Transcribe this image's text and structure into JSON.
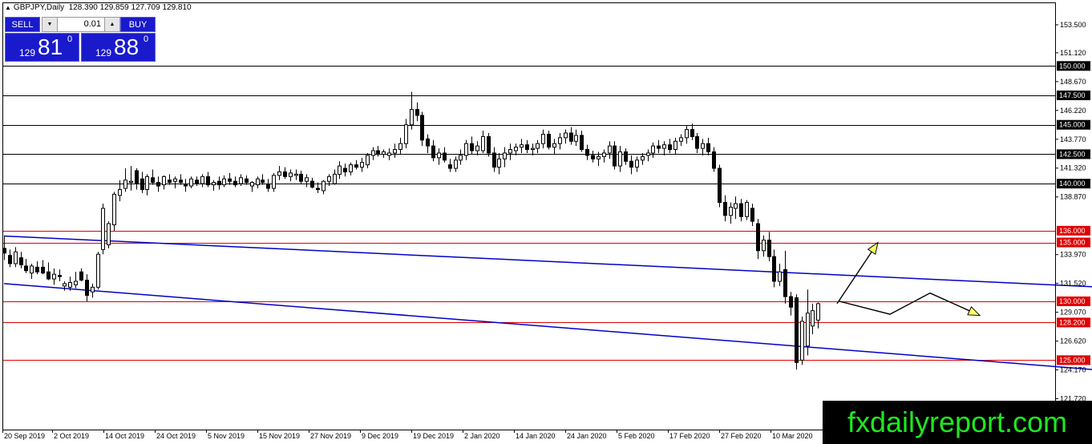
{
  "header": {
    "symbol": "GBPJPY,Daily",
    "ohlc": "128.390 129.859 127.709 129.810"
  },
  "trade_panel": {
    "sell_label": "SELL",
    "buy_label": "BUY",
    "lot": "0.01",
    "sell_prefix": "129",
    "sell_big": "81",
    "sell_sup": "0",
    "buy_prefix": "129",
    "buy_big": "88",
    "buy_sup": "0"
  },
  "watermark": "fxdailyreport.com",
  "colors": {
    "background": "#ffffff",
    "bull_candle": "#ffffff",
    "bear_candle": "#000000",
    "black_level": "#000000",
    "red_level": "#e00000",
    "trendline": "#0000c8",
    "arrow_fill": "#ffff66",
    "panel_blue": "#1a1acd",
    "watermark_text": "#1ee81e"
  },
  "chart_data": {
    "type": "candlestick",
    "title": "GBPJPY,Daily",
    "xlabel": "",
    "ylabel": "",
    "ylim": [
      119.1,
      155.4
    ],
    "y_ticks": [
      "153.500",
      "151.120",
      "148.670",
      "146.220",
      "143.770",
      "141.320",
      "138.870",
      "133.970",
      "131.520",
      "129.070",
      "126.620",
      "124.170",
      "121.720"
    ],
    "x_ticks": [
      "20 Sep 2019",
      "2 Oct 2019",
      "14 Oct 2019",
      "24 Oct 2019",
      "5 Nov 2019",
      "15 Nov 2019",
      "27 Nov 2019",
      "9 Dec 2019",
      "19 Dec 2019",
      "2 Jan 2020",
      "14 Jan 2020",
      "24 Jan 2020",
      "5 Feb 2020",
      "17 Feb 2020",
      "27 Feb 2020",
      "10 Mar 2020"
    ],
    "levels": [
      {
        "price": 150.0,
        "label": "150.000",
        "style": "black"
      },
      {
        "price": 147.5,
        "label": "147.500",
        "style": "black"
      },
      {
        "price": 145.0,
        "label": "145.000",
        "style": "black"
      },
      {
        "price": 142.5,
        "label": "142.500",
        "style": "black"
      },
      {
        "price": 140.0,
        "label": "140.000",
        "style": "black"
      },
      {
        "price": 136.0,
        "label": "136.000",
        "style": "red"
      },
      {
        "price": 135.0,
        "label": "135.000",
        "style": "red"
      },
      {
        "price": 130.0,
        "label": "130.000",
        "style": "red"
      },
      {
        "price": 128.2,
        "label": "128.200",
        "style": "red"
      },
      {
        "price": 125.0,
        "label": "125.000",
        "style": "red"
      }
    ],
    "trendlines": [
      {
        "x0": 0,
        "y0": 135.55,
        "x1": 299,
        "y1": 129.03
      },
      {
        "x0": 0,
        "y0": 131.5,
        "x1": 299,
        "y1": 120.48
      }
    ],
    "arrows": [
      {
        "path": [
          [
            1044,
            129.8
          ],
          [
            1095,
            135.0
          ]
        ]
      },
      {
        "path": [
          [
            1047,
            130.0
          ],
          [
            1110,
            128.9
          ],
          [
            1160,
            130.7
          ],
          [
            1222,
            128.8
          ]
        ]
      }
    ],
    "candles": [
      [
        0,
        134.5,
        135.6,
        133.5,
        134.1
      ],
      [
        1,
        133.9,
        134.4,
        132.9,
        133.2
      ],
      [
        2,
        133.2,
        134.6,
        132.9,
        134.2
      ],
      [
        3,
        133.7,
        134.2,
        132.8,
        133.1
      ],
      [
        4,
        133.0,
        133.6,
        132.4,
        132.6
      ],
      [
        5,
        132.4,
        133.2,
        131.9,
        133.0
      ],
      [
        6,
        132.9,
        133.4,
        132.3,
        132.5
      ],
      [
        7,
        132.9,
        133.5,
        132.3,
        132.4
      ],
      [
        8,
        132.5,
        133.3,
        131.8,
        131.9
      ],
      [
        9,
        131.9,
        132.8,
        131.4,
        132.3
      ],
      [
        10,
        132.2,
        132.7,
        131.7,
        132.1
      ],
      [
        11,
        131.3,
        131.7,
        130.9,
        131.5
      ],
      [
        12,
        131.2,
        132.1,
        130.9,
        131.6
      ],
      [
        13,
        131.4,
        132.5,
        131.1,
        131.7
      ],
      [
        14,
        132.5,
        132.8,
        131.7,
        131.8
      ],
      [
        15,
        131.8,
        132.3,
        130.0,
        130.5
      ],
      [
        16,
        130.8,
        131.5,
        130.3,
        131.2
      ],
      [
        17,
        131.2,
        134.2,
        131.0,
        134.0
      ],
      [
        18,
        134.4,
        138.3,
        134.0,
        137.9
      ],
      [
        19,
        134.8,
        136.8,
        134.5,
        136.6
      ],
      [
        20,
        136.5,
        139.3,
        136.0,
        139.1
      ],
      [
        21,
        139.0,
        140.3,
        138.5,
        139.5
      ],
      [
        22,
        139.6,
        141.3,
        139.3,
        140.3
      ],
      [
        23,
        140.1,
        141.5,
        139.4,
        140.2
      ],
      [
        24,
        141.1,
        141.3,
        139.5,
        140.0
      ],
      [
        25,
        140.4,
        141.0,
        139.2,
        139.5
      ],
      [
        26,
        139.5,
        140.8,
        139.0,
        140.6
      ],
      [
        27,
        140.5,
        141.2,
        139.9,
        140.1
      ],
      [
        28,
        140.1,
        140.6,
        139.3,
        139.8
      ],
      [
        29,
        139.9,
        140.7,
        139.5,
        140.6
      ],
      [
        30,
        140.3,
        140.8,
        139.9,
        140.1
      ],
      [
        31,
        140.2,
        140.6,
        139.6,
        140.4
      ],
      [
        32,
        140.3,
        140.8,
        139.9,
        140.1
      ],
      [
        33,
        139.9,
        140.4,
        139.3,
        139.8
      ],
      [
        34,
        139.8,
        140.6,
        139.6,
        140.4
      ],
      [
        35,
        140.3,
        140.6,
        139.8,
        140.0
      ],
      [
        36,
        140.0,
        140.8,
        139.7,
        140.6
      ],
      [
        37,
        140.6,
        141.0,
        139.7,
        139.9
      ],
      [
        38,
        139.9,
        140.3,
        139.4,
        140.1
      ],
      [
        39,
        140.2,
        140.6,
        139.5,
        139.9
      ],
      [
        40,
        139.9,
        140.7,
        139.7,
        140.4
      ],
      [
        41,
        140.4,
        140.9,
        139.9,
        140.2
      ],
      [
        42,
        140.2,
        140.6,
        139.7,
        139.9
      ],
      [
        43,
        140.0,
        140.8,
        139.8,
        140.5
      ],
      [
        44,
        140.4,
        140.7,
        139.9,
        140.1
      ],
      [
        45,
        139.8,
        140.2,
        139.3,
        140.1
      ],
      [
        46,
        139.9,
        140.6,
        139.6,
        140.4
      ],
      [
        47,
        140.3,
        140.8,
        139.9,
        140.1
      ],
      [
        48,
        139.9,
        140.4,
        139.3,
        139.6
      ],
      [
        49,
        139.6,
        140.9,
        139.3,
        140.7
      ],
      [
        50,
        140.7,
        141.5,
        140.3,
        141.0
      ],
      [
        51,
        141.0,
        141.4,
        140.4,
        140.6
      ],
      [
        52,
        140.6,
        141.2,
        140.2,
        140.9
      ],
      [
        53,
        140.7,
        141.2,
        140.3,
        140.8
      ],
      [
        54,
        140.8,
        141.1,
        140.0,
        140.2
      ],
      [
        55,
        140.2,
        140.8,
        139.7,
        140.5
      ],
      [
        56,
        140.2,
        140.5,
        139.6,
        139.7
      ],
      [
        57,
        139.6,
        140.1,
        139.2,
        139.5
      ],
      [
        58,
        139.4,
        140.3,
        139.1,
        140.2
      ],
      [
        59,
        140.2,
        140.8,
        139.8,
        140.6
      ],
      [
        60,
        140.0,
        141.2,
        139.9,
        140.8
      ],
      [
        61,
        140.8,
        141.9,
        140.4,
        141.5
      ],
      [
        62,
        141.3,
        141.7,
        140.6,
        141.0
      ],
      [
        63,
        141.0,
        141.8,
        140.7,
        141.6
      ],
      [
        64,
        141.6,
        142.0,
        141.2,
        141.4
      ],
      [
        65,
        141.4,
        142.2,
        141.0,
        141.8
      ],
      [
        66,
        141.6,
        142.6,
        141.3,
        142.4
      ],
      [
        67,
        142.4,
        143.1,
        142.0,
        142.8
      ],
      [
        68,
        142.8,
        143.2,
        142.3,
        142.5
      ],
      [
        69,
        142.5,
        142.9,
        142.2,
        142.7
      ],
      [
        70,
        142.4,
        143.0,
        142.0,
        142.6
      ],
      [
        71,
        142.6,
        143.4,
        142.2,
        142.9
      ],
      [
        72,
        142.9,
        143.9,
        142.5,
        143.4
      ],
      [
        73,
        143.4,
        145.5,
        143.0,
        145.0
      ],
      [
        74,
        145.0,
        147.8,
        144.6,
        146.3
      ],
      [
        75,
        146.3,
        146.9,
        145.3,
        145.8
      ],
      [
        76,
        145.8,
        146.1,
        143.2,
        143.7
      ],
      [
        77,
        143.8,
        144.2,
        142.6,
        143.2
      ],
      [
        78,
        143.2,
        143.7,
        141.9,
        142.2
      ],
      [
        79,
        142.2,
        143.0,
        141.6,
        142.6
      ],
      [
        80,
        142.6,
        143.1,
        141.8,
        142.0
      ],
      [
        81,
        141.6,
        142.1,
        141.0,
        141.3
      ],
      [
        82,
        141.3,
        142.3,
        141.0,
        142.0
      ],
      [
        83,
        142.0,
        142.9,
        141.6,
        142.4
      ],
      [
        84,
        142.4,
        143.7,
        142.0,
        143.4
      ],
      [
        85,
        143.4,
        144.0,
        142.5,
        142.8
      ],
      [
        86,
        142.8,
        143.6,
        142.4,
        143.2
      ],
      [
        87,
        142.8,
        144.5,
        142.6,
        144.0
      ],
      [
        88,
        144.0,
        144.3,
        142.3,
        142.6
      ],
      [
        89,
        142.6,
        143.1,
        141.0,
        141.4
      ],
      [
        90,
        141.4,
        142.6,
        140.8,
        142.1
      ],
      [
        91,
        142.1,
        143.1,
        141.4,
        142.6
      ],
      [
        92,
        142.6,
        143.4,
        142.0,
        142.9
      ],
      [
        93,
        142.8,
        143.4,
        142.4,
        143.1
      ],
      [
        94,
        143.1,
        143.8,
        142.6,
        143.3
      ],
      [
        95,
        143.3,
        143.7,
        142.6,
        142.9
      ],
      [
        96,
        142.9,
        143.4,
        142.4,
        143.0
      ],
      [
        97,
        143.0,
        143.7,
        142.6,
        143.4
      ],
      [
        98,
        143.4,
        144.6,
        143.0,
        144.2
      ],
      [
        99,
        144.2,
        144.5,
        142.9,
        143.1
      ],
      [
        100,
        143.1,
        143.8,
        142.5,
        143.4
      ],
      [
        101,
        143.4,
        144.3,
        142.9,
        143.9
      ],
      [
        102,
        143.9,
        144.6,
        143.4,
        144.3
      ],
      [
        103,
        144.3,
        144.8,
        143.3,
        143.6
      ],
      [
        104,
        143.6,
        144.6,
        143.2,
        144.1
      ],
      [
        105,
        144.1,
        144.5,
        142.7,
        142.9
      ],
      [
        106,
        142.9,
        143.3,
        142.0,
        142.4
      ],
      [
        107,
        142.4,
        142.8,
        141.8,
        142.1
      ],
      [
        108,
        142.1,
        142.7,
        141.5,
        142.3
      ],
      [
        109,
        142.3,
        142.9,
        141.8,
        142.6
      ],
      [
        110,
        142.6,
        143.6,
        142.1,
        143.2
      ],
      [
        111,
        143.2,
        143.6,
        141.2,
        141.5
      ],
      [
        112,
        141.5,
        143.2,
        141.0,
        142.7
      ],
      [
        113,
        142.7,
        143.0,
        141.6,
        141.9
      ],
      [
        114,
        141.9,
        142.4,
        140.8,
        141.4
      ],
      [
        115,
        141.4,
        142.3,
        141.0,
        142.0
      ],
      [
        116,
        142.0,
        142.6,
        141.6,
        142.3
      ],
      [
        117,
        142.4,
        142.9,
        141.9,
        142.6
      ],
      [
        118,
        142.6,
        143.5,
        142.2,
        143.2
      ],
      [
        119,
        143.2,
        143.7,
        142.6,
        143.0
      ],
      [
        120,
        143.0,
        143.6,
        142.4,
        143.3
      ],
      [
        121,
        143.3,
        143.8,
        142.6,
        142.9
      ],
      [
        122,
        142.9,
        143.9,
        142.5,
        143.6
      ],
      [
        123,
        143.6,
        144.2,
        143.2,
        143.9
      ],
      [
        124,
        143.9,
        144.9,
        143.4,
        144.6
      ],
      [
        125,
        144.6,
        145.1,
        143.7,
        144.0
      ],
      [
        126,
        144.0,
        144.3,
        142.6,
        143.0
      ],
      [
        127,
        143.0,
        143.8,
        142.4,
        143.4
      ],
      [
        128,
        143.4,
        143.9,
        142.4,
        142.7
      ],
      [
        129,
        142.7,
        143.1,
        141.0,
        141.3
      ],
      [
        130,
        141.3,
        141.6,
        138.0,
        138.4
      ],
      [
        131,
        138.4,
        139.0,
        136.8,
        137.3
      ],
      [
        132,
        137.3,
        138.4,
        136.6,
        138.0
      ],
      [
        133,
        137.9,
        138.9,
        137.0,
        138.3
      ],
      [
        134,
        138.3,
        138.7,
        136.8,
        137.2
      ],
      [
        135,
        137.2,
        138.6,
        136.9,
        138.4
      ],
      [
        136,
        137.9,
        138.3,
        136.4,
        136.8
      ],
      [
        137,
        136.6,
        137.0,
        133.6,
        134.3
      ],
      [
        138,
        134.3,
        135.6,
        133.8,
        135.2
      ],
      [
        139,
        135.2,
        135.9,
        133.4,
        133.8
      ],
      [
        140,
        133.8,
        134.4,
        131.2,
        131.7
      ],
      [
        141,
        131.7,
        133.2,
        131.3,
        132.5
      ],
      [
        142,
        132.7,
        134.3,
        129.8,
        130.4
      ],
      [
        143,
        130.4,
        130.8,
        128.8,
        129.5
      ],
      [
        144,
        130.3,
        130.6,
        124.2,
        124.8
      ],
      [
        145,
        125.0,
        128.7,
        124.6,
        128.3
      ],
      [
        146,
        126.2,
        131.0,
        125.4,
        129.0
      ],
      [
        147,
        127.9,
        129.8,
        127.2,
        129.2
      ],
      [
        148,
        128.4,
        129.9,
        127.7,
        129.8
      ]
    ]
  }
}
